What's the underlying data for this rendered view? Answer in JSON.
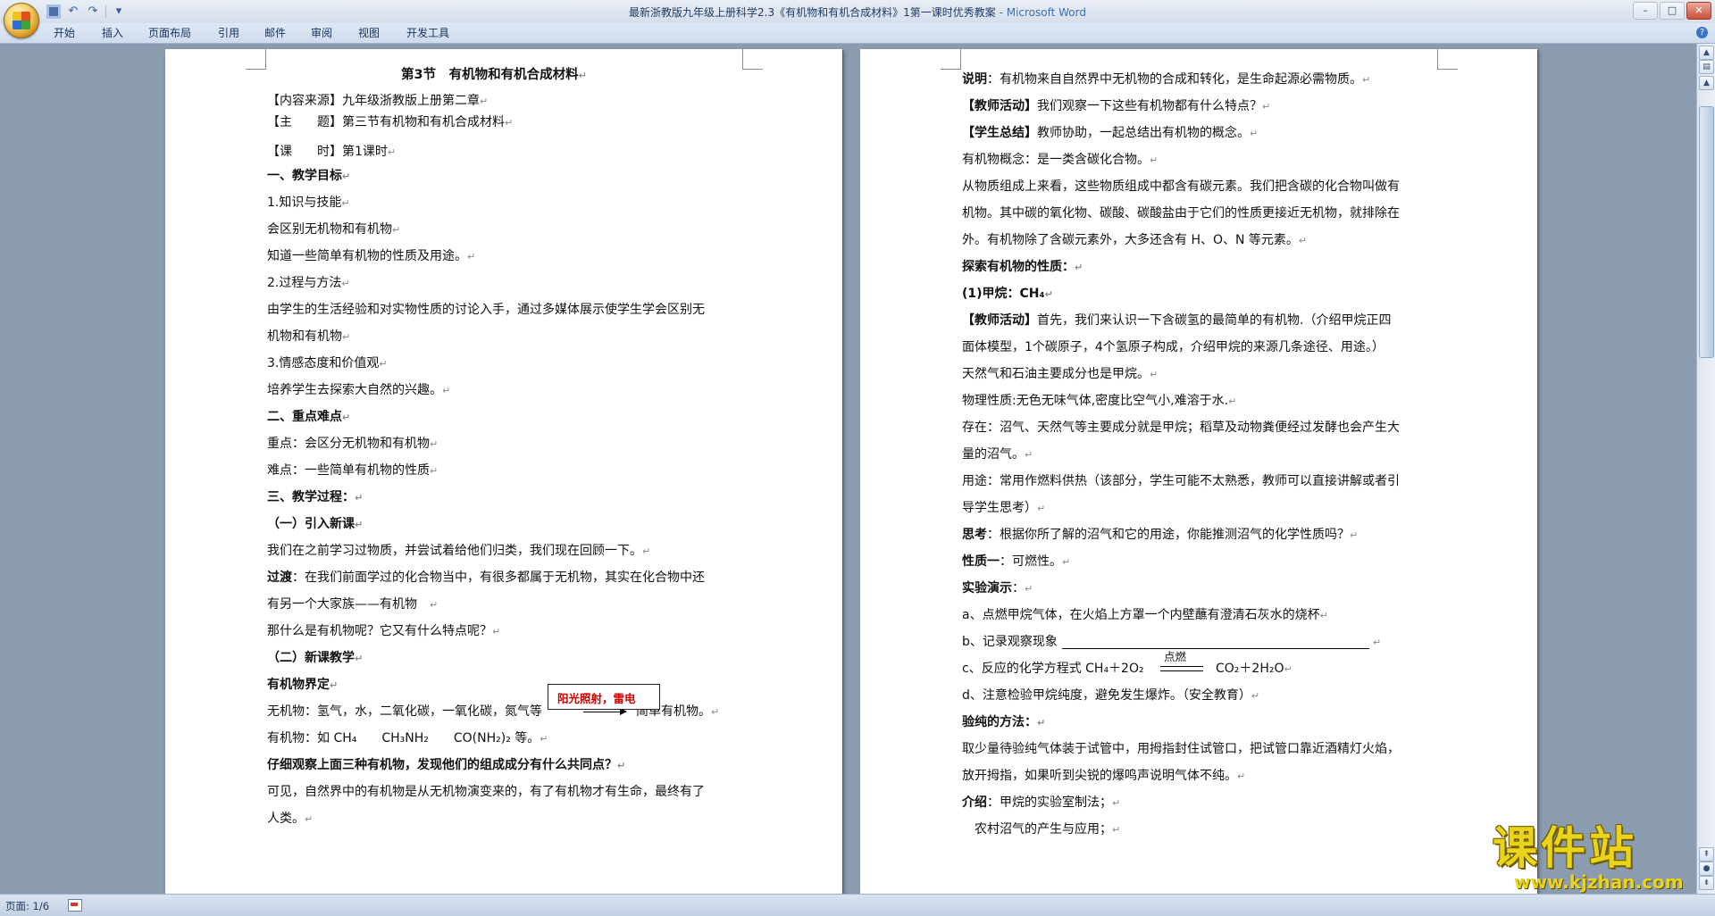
{
  "window": {
    "title": "最新浙教版九年级上册科学2.3《有机物和有机合成材料》1第一课时优秀教案",
    "app_suffix": " - Microsoft Word",
    "controls": {
      "minimize": "–",
      "maximize": "□",
      "close": "✕"
    }
  },
  "qat": {
    "undo": "↶",
    "redo": "↷",
    "more": "▾"
  },
  "ribbon": {
    "tabs": [
      "开始",
      "插入",
      "页面布局",
      "引用",
      "邮件",
      "审阅",
      "视图",
      "开发工具"
    ],
    "help": "?"
  },
  "left_page": {
    "title": "第3节　有机物和有机合成材料",
    "lines": [
      "【内容来源】九年级浙教版上册第二章",
      "【主　　题】第三节有机物和有机合成材料",
      "【课　　时】第1课时",
      "一、教学目标",
      "1.知识与技能",
      "会区别无机物和有机物",
      "知道一些简单有机物的性质及用途。",
      "2.过程与方法",
      "由学生的生活经验和对实物性质的讨论入手，通过多媒体展示使学生学会区别无",
      "机物和有机物",
      "3.情感态度和价值观",
      "培养学生去探索大自然的兴趣。",
      "二、重点难点",
      "重点：会区分无机物和有机物",
      "难点：一些简单有机物的性质",
      "三、教学过程：",
      "（一）引入新课",
      "我们在之前学习过物质，并尝试着给他们归类，我们现在回顾一下。",
      "过渡",
      "：在我们前面学过的化合物当中，有很多都属于无机物，其实在化合物中还",
      "有另一个大家族——有机物",
      "那什么是有机物呢？它又有什么特点呢？",
      "（二）新课教学",
      "有机物界定",
      "无机物：氢气，水，二氧化碳，一氧化碳，氮气等",
      "简单有机物。",
      "有机物：如 CH₄　　CH₃NH₂　　CO(NH₂)₂ 等。",
      "仔细观察上面三种有机物，发现他们的组成成分有什么共同点？",
      "可见，自然界中的有机物是从无机物演变来的，有了有机物才有生命，最终有了",
      "人类。"
    ],
    "callout": "阳光照射，雷电"
  },
  "right_page": {
    "lines": [
      "说明",
      "：有机物来自自然界中无机物的合成和转化，是生命起源必需物质。",
      "【教师活动】",
      "我们观察一下这些有机物都有什么特点？",
      "【学生总结】",
      "教师协助，一起总结出有机物的概念。",
      "有机物概念：是一类含碳化合物。",
      "从物质组成上来看，这些物质组成中都含有碳元素。我们把含碳的化合物叫做有",
      "机物。其中碳的氧化物、碳酸、碳酸盐由于它们的性质更接近无机物，就排除在",
      "外。有机物除了含碳元素外，大多还含有 H、O、N 等元素。",
      "探索有机物的性质：",
      "(1)甲烷：CH₄",
      "【教师活动】",
      "首先，我们来认识一下含碳氢的最简单的有机物.（介绍甲烷正四",
      "面体模型，1个碳原子，4个氢原子构成，介绍甲烷的来源几条途径、用途。）",
      "天然气和石油主要成分也是甲烷。",
      "物理性质:无色无味气体,密度比空气小,难溶于水.",
      "存在：沼气、天然气等主要成分就是甲烷；稻草及动物粪便经过发酵也会产生大",
      "量的沼气。",
      "用途：常用作燃料供热（该部分，学生可能不太熟悉，教师可以直接讲解或者引",
      "导学生思考）",
      "思考",
      "：根据你所了解的沼气和它的用途，你能推测沼气的化学性质吗？",
      "性质一",
      "：可燃性。",
      "实验演示",
      "：",
      "a、点燃甲烷气体，在火焰上方罩一个内壁蘸有澄清石灰水的烧杯",
      "b、记录观察现象",
      "c、反应的化学方程式 CH₄＋2O₂",
      "点燃",
      "CO₂＋2H₂O",
      "d、注意检验甲烷纯度，避免发生爆炸。（安全教育）",
      "验纯的方法：",
      "取少量待验纯气体装于试管中，用拇指封住试管口，把试管口靠近酒精灯火焰，",
      "放开拇指，如果听到尖锐的爆鸣声说明气体不纯。",
      "介绍",
      "：甲烷的实验室制法；",
      "　农村沼气的产生与应用；"
    ]
  },
  "para_mark": "↵",
  "status": {
    "page": "页面: 1/6"
  },
  "watermark": {
    "title": "课件站",
    "url": "www.kjzhan.com"
  }
}
